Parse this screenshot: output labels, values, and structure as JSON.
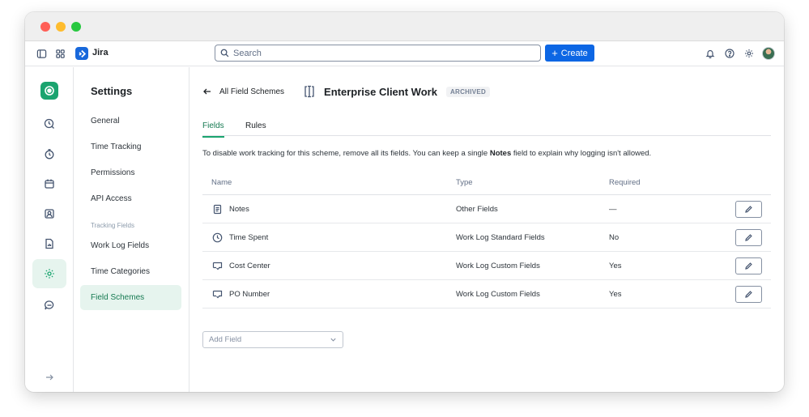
{
  "app": {
    "name": "Jira",
    "search_placeholder": "Search",
    "create_label": "Create"
  },
  "settings_nav": {
    "title": "Settings",
    "items_top": [
      {
        "label": "General"
      },
      {
        "label": "Time Tracking"
      },
      {
        "label": "Permissions"
      },
      {
        "label": "API Access"
      }
    ],
    "section_label": "Tracking Fields",
    "items_bottom": [
      {
        "label": "Work Log Fields"
      },
      {
        "label": "Time Categories"
      },
      {
        "label": "Field Schemes",
        "active": true
      }
    ]
  },
  "header": {
    "back_label": "All Field Schemes",
    "title": "Enterprise Client Work",
    "badge": "ARCHIVED"
  },
  "tabs": [
    {
      "label": "Fields",
      "active": true
    },
    {
      "label": "Rules"
    }
  ],
  "description": {
    "before": "To disable work tracking for this scheme, remove all its fields. You can keep a single ",
    "bold": "Notes",
    "after": " field to explain why logging isn't allowed."
  },
  "table": {
    "columns": [
      "Name",
      "Type",
      "Required"
    ],
    "rows": [
      {
        "name": "Notes",
        "icon": "document-icon",
        "type": "Other Fields",
        "required": "—"
      },
      {
        "name": "Time Spent",
        "icon": "clock-icon",
        "type": "Work Log Standard Fields",
        "required": "No"
      },
      {
        "name": "Cost Center",
        "icon": "comment-check-icon",
        "type": "Work Log Custom Fields",
        "required": "Yes"
      },
      {
        "name": "PO Number",
        "icon": "comment-check-icon",
        "type": "Work Log Custom Fields",
        "required": "Yes"
      }
    ]
  },
  "add_field": {
    "placeholder": "Add Field"
  },
  "colors": {
    "accent_green": "#1aa46f",
    "active_bg": "#e6f4ee",
    "primary_blue": "#0c66e4"
  }
}
